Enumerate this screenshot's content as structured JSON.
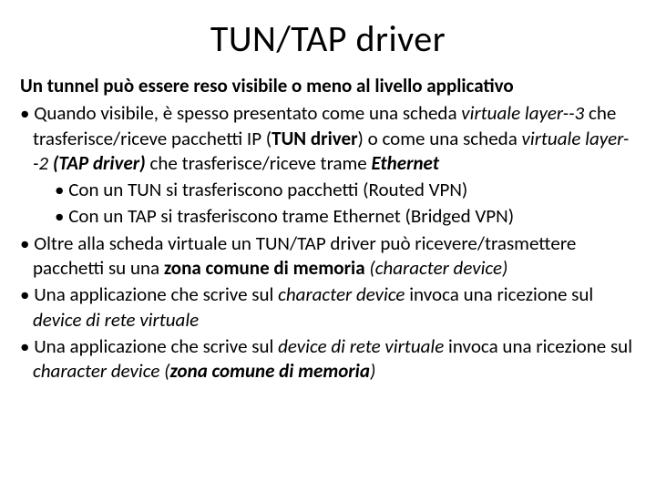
{
  "title": "TUN/TAP driver",
  "intro": "Un tunnel può essere reso visibile o meno al livello applicativo",
  "b1": {
    "pre": "• Quando visibile, è spesso presentato come una scheda ",
    "virtuale_l3": "virtuale layer--3 ",
    "mid1": "che trasferisce/riceve pacchetti IP (",
    "tun_driver": "TUN driver",
    "mid2": ") o come una scheda ",
    "virtuale_l2": "virtuale layer--2 ",
    "tap_open": "(",
    "tap_driver": "TAP driver",
    "tap_close": ") ",
    "mid3": "che trasferisce/riceve trame ",
    "eth": "Ethernet"
  },
  "b1a": "• Con un TUN si trasferiscono pacchetti (Routed VPN)",
  "b1b": "• Con un TAP si trasferiscono trame Ethernet (Bridged VPN)",
  "b2": {
    "pre": "• Oltre alla scheda virtuale un TUN/TAP driver può ricevere/trasmettere pacchetti su una ",
    "zona": "zona comune di memoria ",
    "char": "(character device)"
  },
  "b3": {
    "pre": "• Una applicazione che scrive sul ",
    "char": "character device ",
    "mid": "invoca  una ricezione sul ",
    "dev": "device di rete virtuale"
  },
  "b4": {
    "pre": "• Una applicazione che scrive sul ",
    "dev": "device di rete virtuale ",
    "mid": "invoca una ricezione sul ",
    "char": "character device ",
    "open": "(",
    "zona": "zona comune di memoria",
    "close": ")"
  }
}
